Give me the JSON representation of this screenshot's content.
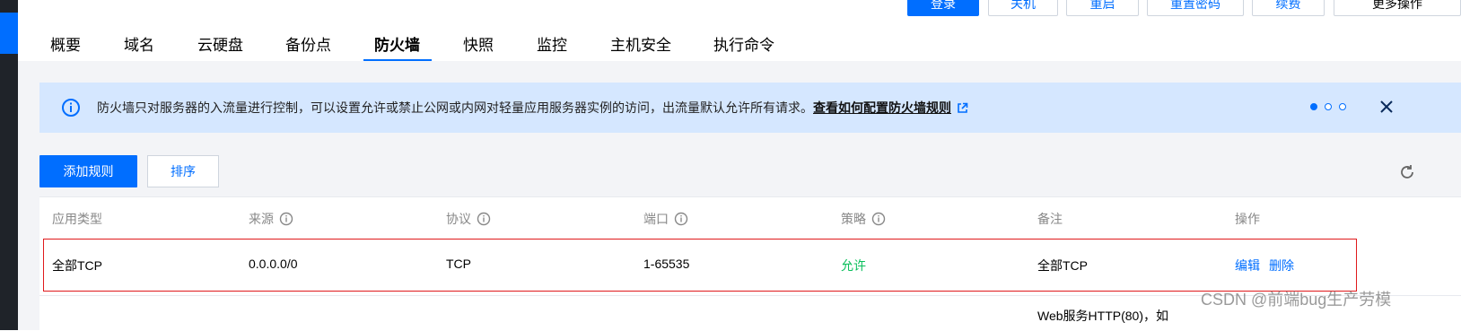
{
  "top_actions": {
    "login": "登录",
    "shutdown": "关机",
    "restart": "重启",
    "reset_password": "重置密码",
    "renew": "续费",
    "more": "更多操作"
  },
  "tabs": [
    {
      "label": "概要"
    },
    {
      "label": "域名"
    },
    {
      "label": "云硬盘"
    },
    {
      "label": "备份点"
    },
    {
      "label": "防火墙"
    },
    {
      "label": "快照"
    },
    {
      "label": "监控"
    },
    {
      "label": "主机安全"
    },
    {
      "label": "执行命令"
    }
  ],
  "active_tab": "防火墙",
  "notice": {
    "text": "防火墙只对服务器的入流量进行控制，可以设置允许或禁止公网或内网对轻量应用服务器实例的访问，出流量默认允许所有请求。",
    "link": "查看如何配置防火墙规则",
    "pager": {
      "current": 1,
      "total": 3
    }
  },
  "toolbar": {
    "add_rule": "添加规则",
    "sort": "排序"
  },
  "table": {
    "headers": [
      "应用类型",
      "来源",
      "协议",
      "端口",
      "策略",
      "备注",
      "操作"
    ],
    "rows": [
      {
        "app_type": "全部TCP",
        "source": "0.0.0.0/0",
        "protocol": "TCP",
        "port": "1-65535",
        "policy": "允许",
        "note": "全部TCP",
        "edit": "编辑",
        "delete": "删除"
      }
    ],
    "next_row_note": "Web服务HTTP(80)，如"
  },
  "watermark": "CSDN @前端bug生产劳模",
  "colors": {
    "accent": "#006eff",
    "allow": "#0abf5b",
    "highlight_border": "#e0191c",
    "notice_bg": "#d5e7ff"
  }
}
